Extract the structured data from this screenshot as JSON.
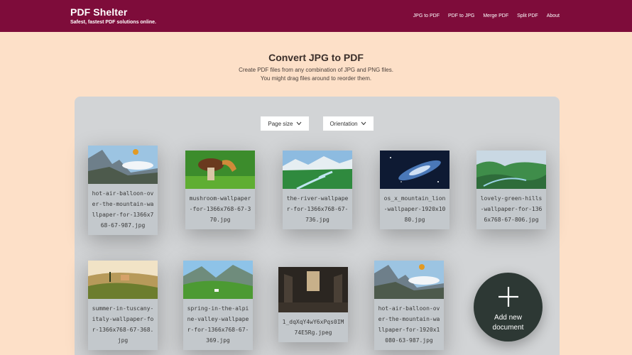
{
  "header": {
    "brand_title": "PDF Shelter",
    "brand_tagline": "Safest, fastest PDF solutions online.",
    "nav": [
      "JPG to PDF",
      "PDF to JPG",
      "Merge PDF",
      "Split PDF",
      "About"
    ],
    "bg_color": "#7e0c3a"
  },
  "main": {
    "title": "Convert JPG to PDF",
    "subtitle_line1": "Create PDF files from any combination of JPG and PNG files.",
    "subtitle_line2": "You might drag files around to reorder them."
  },
  "controls": {
    "page_size_label": "Page size",
    "orientation_label": "Orientation"
  },
  "files": [
    {
      "name": "hot-air-balloon-over-the-mountain-wallpaper-for-1366x768-67-987.jpg",
      "icon": "balloon-mountain-image"
    },
    {
      "name": "mushroom-wallpaper-for-1366x768-67-370.jpg",
      "icon": "mushroom-image"
    },
    {
      "name": "the-river-wallpaper-for-1366x768-67-736.jpg",
      "icon": "river-image"
    },
    {
      "name": "os_x_mountain_lion-wallpaper-1920x1080.jpg",
      "icon": "space-image"
    },
    {
      "name": "lovely-green-hills-wallpaper-for-1366x768-67-806.jpg",
      "icon": "green-hills-image"
    },
    {
      "name": "summer-in-tuscany-italy-wallpaper-for-1366x768-67-368.jpg",
      "icon": "tuscany-image"
    },
    {
      "name": "spring-in-the-alpine-valley-wallpaper-for-1366x768-67-369.jpg",
      "icon": "alpine-valley-image"
    },
    {
      "name": "1_dqXqY4wY6xPqs0IM74E5Rg.jpeg",
      "icon": "church-interior-image"
    },
    {
      "name": "hot-air-balloon-over-the-mountain-wallpaper-for-1920x1080-63-987.jpg",
      "icon": "balloon-mountain-image"
    }
  ],
  "add_button": {
    "line1": "Add new",
    "line2": "document"
  }
}
